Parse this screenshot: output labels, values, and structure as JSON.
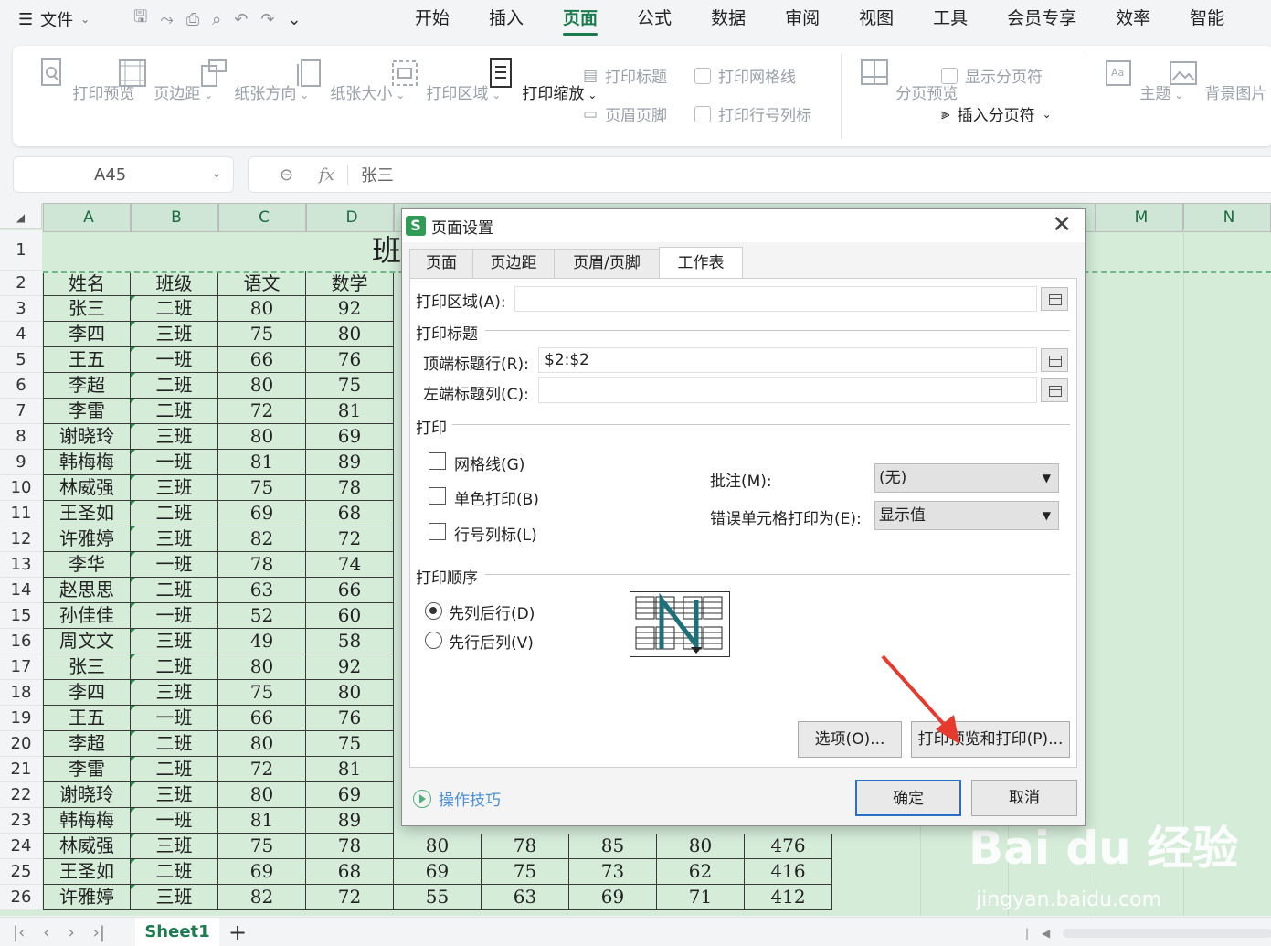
{
  "menu": {
    "file_label": "文件",
    "tabs": [
      "开始",
      "插入",
      "页面",
      "公式",
      "数据",
      "审阅",
      "视图",
      "工具",
      "会员专享",
      "效率",
      "智能"
    ],
    "active_tab": "页面"
  },
  "ribbon": {
    "print_preview": "打印预览",
    "margins": "页边距",
    "orientation": "纸张方向",
    "paper_size": "纸张大小",
    "print_area": "打印区域",
    "print_scale": "打印缩放",
    "print_titles": "打印标题",
    "header_footer": "页眉页脚",
    "print_gridlines": "打印网格线",
    "print_row_col_headers": "打印行号列标",
    "page_break_preview": "分页预览",
    "show_page_breaks": "显示分页符",
    "insert_page_break": "插入分页符",
    "theme": "主题",
    "background": "背景图片"
  },
  "formula_bar": {
    "name_box": "A45",
    "fx": "fx",
    "value": "张三"
  },
  "sheet": {
    "columns_left": [
      "A",
      "B",
      "C",
      "D"
    ],
    "columns_right": [
      "M",
      "N"
    ],
    "title_partial": "班",
    "header_row": [
      "姓名",
      "班级",
      "语文",
      "数学"
    ],
    "rows": [
      [
        "张三",
        "二班",
        "80",
        "92"
      ],
      [
        "李四",
        "三班",
        "75",
        "80"
      ],
      [
        "王五",
        "一班",
        "66",
        "76"
      ],
      [
        "李超",
        "二班",
        "80",
        "75"
      ],
      [
        "李雷",
        "二班",
        "72",
        "81"
      ],
      [
        "谢晓玲",
        "三班",
        "80",
        "69"
      ],
      [
        "韩梅梅",
        "一班",
        "81",
        "89"
      ],
      [
        "林威强",
        "三班",
        "75",
        "78"
      ],
      [
        "王圣如",
        "二班",
        "69",
        "68"
      ],
      [
        "许雅婷",
        "三班",
        "82",
        "72"
      ],
      [
        "李华",
        "一班",
        "78",
        "74"
      ],
      [
        "赵思思",
        "二班",
        "63",
        "66"
      ],
      [
        "孙佳佳",
        "一班",
        "52",
        "60"
      ],
      [
        "周文文",
        "三班",
        "49",
        "58"
      ],
      [
        "张三",
        "二班",
        "80",
        "92"
      ],
      [
        "李四",
        "三班",
        "75",
        "80"
      ],
      [
        "王五",
        "一班",
        "66",
        "76"
      ],
      [
        "李超",
        "二班",
        "80",
        "75"
      ],
      [
        "李雷",
        "二班",
        "72",
        "81"
      ],
      [
        "谢晓玲",
        "三班",
        "80",
        "69"
      ],
      [
        "韩梅梅",
        "一班",
        "81",
        "89"
      ],
      [
        "林威强",
        "三班",
        "75",
        "78"
      ],
      [
        "王圣如",
        "二班",
        "69",
        "68"
      ],
      [
        "许雅婷",
        "三班",
        "82",
        "72"
      ]
    ],
    "extra_rows": [
      [
        "80",
        "78",
        "85",
        "80",
        "476"
      ],
      [
        "69",
        "75",
        "73",
        "62",
        "416"
      ],
      [
        "55",
        "63",
        "69",
        "71",
        "412"
      ]
    ],
    "sheet_tab": "Sheet1"
  },
  "dialog": {
    "title": "页面设置",
    "tabs": [
      "页面",
      "页边距",
      "页眉/页脚",
      "工作表"
    ],
    "active_tab": "工作表",
    "print_area_label": "打印区域(A):",
    "print_titles_label": "打印标题",
    "top_rows_label": "顶端标题行(R):",
    "top_rows_value": "$2:$2",
    "left_cols_label": "左端标题列(C):",
    "left_cols_value": "",
    "print_label": "打印",
    "gridlines_label": "网格线(G)",
    "mono_label": "单色打印(B)",
    "rowcol_label": "行号列标(L)",
    "comments_label": "批注(M):",
    "comments_value": "(无)",
    "errors_label": "错误单元格打印为(E):",
    "errors_value": "显示值",
    "order_label": "打印顺序",
    "down_then_over": "先列后行(D)",
    "over_then_down": "先行后列(V)",
    "options_btn": "选项(O)...",
    "print_preview_btn": "打印预览和打印(P)...",
    "tips": "操作技巧",
    "ok_btn": "确定",
    "cancel_btn": "取消"
  },
  "watermark": {
    "logo": "Bai du 经验",
    "url": "jingyan.baidu.com"
  }
}
